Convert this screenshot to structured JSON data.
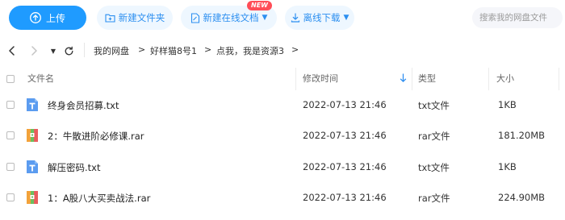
{
  "toolbar": {
    "upload_label": "上传",
    "new_folder_label": "新建文件夹",
    "new_online_doc_label": "新建在线文档",
    "new_badge": "NEW",
    "offline_download_label": "离线下载",
    "search_placeholder": "搜索我的网盘文件"
  },
  "nav": {
    "breadcrumb": [
      "我的网盘",
      "好样猫8号1",
      "点我，我是资源3"
    ],
    "separator": ">"
  },
  "table": {
    "headers": {
      "name": "文件名",
      "modified": "修改时间",
      "type": "类型",
      "size": "大小"
    },
    "rows": [
      {
        "name": "终身会员招募.txt",
        "modified": "2022-07-13 21:46",
        "type": "txt文件",
        "size": "1KB",
        "icon": "txt-file-icon"
      },
      {
        "name": "2：牛散进阶必修课.rar",
        "modified": "2022-07-13 21:46",
        "type": "rar文件",
        "size": "181.20MB",
        "icon": "rar-file-icon"
      },
      {
        "name": "解压密码.txt",
        "modified": "2022-07-13 21:46",
        "type": "txt文件",
        "size": "1KB",
        "icon": "txt-file-icon"
      },
      {
        "name": "1：A股八大买卖战法.rar",
        "modified": "2022-07-13 21:46",
        "type": "rar文件",
        "size": "224.90MB",
        "icon": "rar-file-icon"
      }
    ]
  },
  "colors": {
    "accent": "#1f9bff",
    "pill_bg": "#eef7ff",
    "pill_text": "#2c8ff0",
    "badge": "#ff4d57",
    "txt_icon": "#5b9cf0",
    "rar_icon_green": "#6bbf5f",
    "rar_icon_orange": "#f2a23a"
  }
}
